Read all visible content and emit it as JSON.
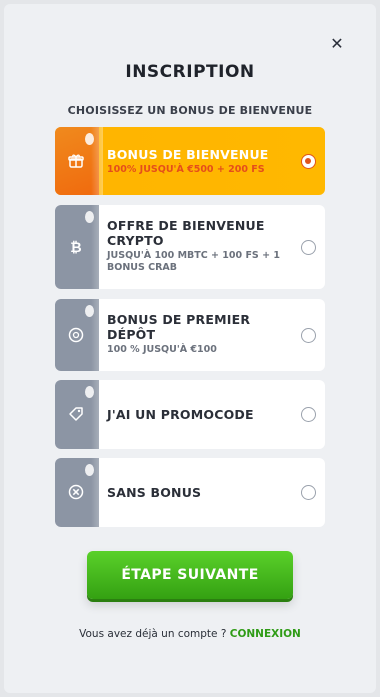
{
  "modal": {
    "title": "INSCRIPTION",
    "subtitle": "CHOISISSEZ UN BONUS DE BIENVENUE",
    "close_icon": "close-icon"
  },
  "options": [
    {
      "name": "BONUS DE BIENVENUE",
      "desc": "100% JUSQU'À €500 + 200 FS",
      "icon": "gift-icon",
      "selected": true
    },
    {
      "name": "OFFRE DE BIENVENUE CRYPTO",
      "desc": "JUSQU'À 100 MBTC + 100 FS + 1 BONUS CRAB",
      "icon": "bitcoin-icon",
      "selected": false
    },
    {
      "name": "BONUS DE PREMIER DÉPÔT",
      "desc": "100 % JUSQU'À €100",
      "icon": "coin-icon",
      "selected": false
    },
    {
      "name": "J'AI UN PROMOCODE",
      "desc": "",
      "icon": "tag-icon",
      "selected": false
    },
    {
      "name": "SANS BONUS",
      "desc": "",
      "icon": "no-bonus-icon",
      "selected": false
    }
  ],
  "footer": {
    "next_label": "ÉTAPE SUIVANTE",
    "login_prompt": "Vous avez déjà un compte ?",
    "login_link": "CONNEXION"
  },
  "colors": {
    "selected_bg": "#ffb400",
    "selected_accent": "#e54e1b",
    "button_green": "#46b91e",
    "link_green": "#2f9c16"
  }
}
